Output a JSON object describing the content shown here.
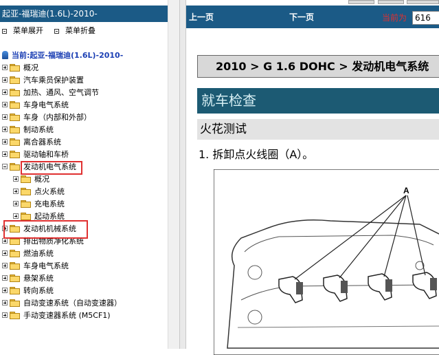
{
  "left_panel": {
    "title": "起亚-福瑞迪(1.6L)-2010-",
    "menu_expand": "菜单展开",
    "menu_collapse": "菜单折叠",
    "current": "当前:起亚-福瑞迪(1.6L)-2010-",
    "tree": [
      {
        "label": "概况",
        "expanded": false
      },
      {
        "label": "汽车乘员保护装置",
        "expanded": false
      },
      {
        "label": "加热、通风、空气调节",
        "expanded": false
      },
      {
        "label": "车身电气系统",
        "expanded": false
      },
      {
        "label": "车身（内部和外部）",
        "expanded": false
      },
      {
        "label": "制动系统",
        "expanded": false
      },
      {
        "label": "离合器系统",
        "expanded": false
      },
      {
        "label": "驱动轴和车桥",
        "expanded": false
      },
      {
        "label": "发动机电气系统",
        "expanded": true,
        "children": [
          "概况",
          "点火系统",
          "充电系统",
          "起动系统"
        ]
      },
      {
        "label": "发动机机械系统",
        "expanded": false
      },
      {
        "label": "排出物质净化系统",
        "expanded": false
      },
      {
        "label": "燃油系统",
        "expanded": false
      },
      {
        "label": "车身电气系统",
        "expanded": false
      },
      {
        "label": "悬架系统",
        "expanded": false
      },
      {
        "label": "转向系统",
        "expanded": false
      },
      {
        "label": "自动变速系统（自动变速器）",
        "expanded": false
      },
      {
        "label": "手动变速器系统 (M5CF1)",
        "expanded": false
      }
    ]
  },
  "nav": {
    "prev": "上一页",
    "next": "下一页",
    "current_label": "当前为",
    "page_value": "616"
  },
  "content": {
    "breadcrumb": "2010 > G 1.6 DOHC > 发动机电气系统",
    "section": "就车检查",
    "subsection": "火花测试",
    "step": "1. 拆卸点火线圈（A）。",
    "figure_label": "A"
  },
  "colors": {
    "header_blue": "#1b5a86",
    "section_teal": "#1c5a73",
    "highlight_red": "#e03030"
  }
}
